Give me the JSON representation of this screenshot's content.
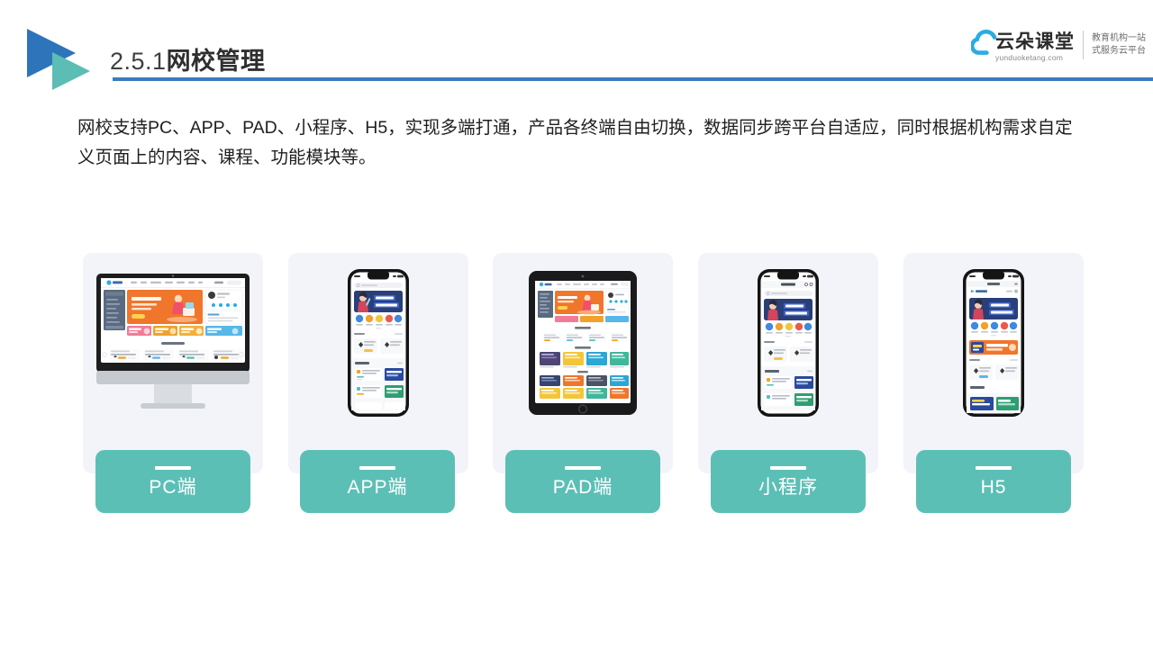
{
  "header": {
    "title_number": "2.5.1",
    "title_text": "网校管理",
    "logo_icon": "double-triangle-play-icon",
    "accent_blue": "#3a7cbe",
    "accent_teal": "#5cbfb6"
  },
  "brand": {
    "cloud_icon": "cloud-icon",
    "name_cn": "云朵课堂",
    "url": "yunduoketang.com",
    "tagline_line1": "教育机构一站",
    "tagline_line2": "式服务云平台",
    "cloud_color": "#29ace3"
  },
  "intro": {
    "paragraph": "网校支持PC、APP、PAD、小程序、H5，实现多端打通，产品各终端自由切换，数据同步跨平台自适应，同时根据机构需求自定义页面上的内容、课程、功能模块等。"
  },
  "cards": [
    {
      "id": "pc",
      "label": "PC端",
      "device": "desktop-monitor-icon"
    },
    {
      "id": "app",
      "label": "APP端",
      "device": "smartphone-icon"
    },
    {
      "id": "pad",
      "label": "PAD端",
      "device": "tablet-icon"
    },
    {
      "id": "mini",
      "label": "小程序",
      "device": "smartphone-icon"
    },
    {
      "id": "h5",
      "label": "H5",
      "device": "smartphone-icon"
    }
  ],
  "mockup": {
    "banner_headline_1": "职场人的",
    "banner_headline_2": "第一堂网课",
    "section_heading": "公开课",
    "section_heading_2": "推荐课程",
    "brand_mini": "云朵课堂"
  }
}
